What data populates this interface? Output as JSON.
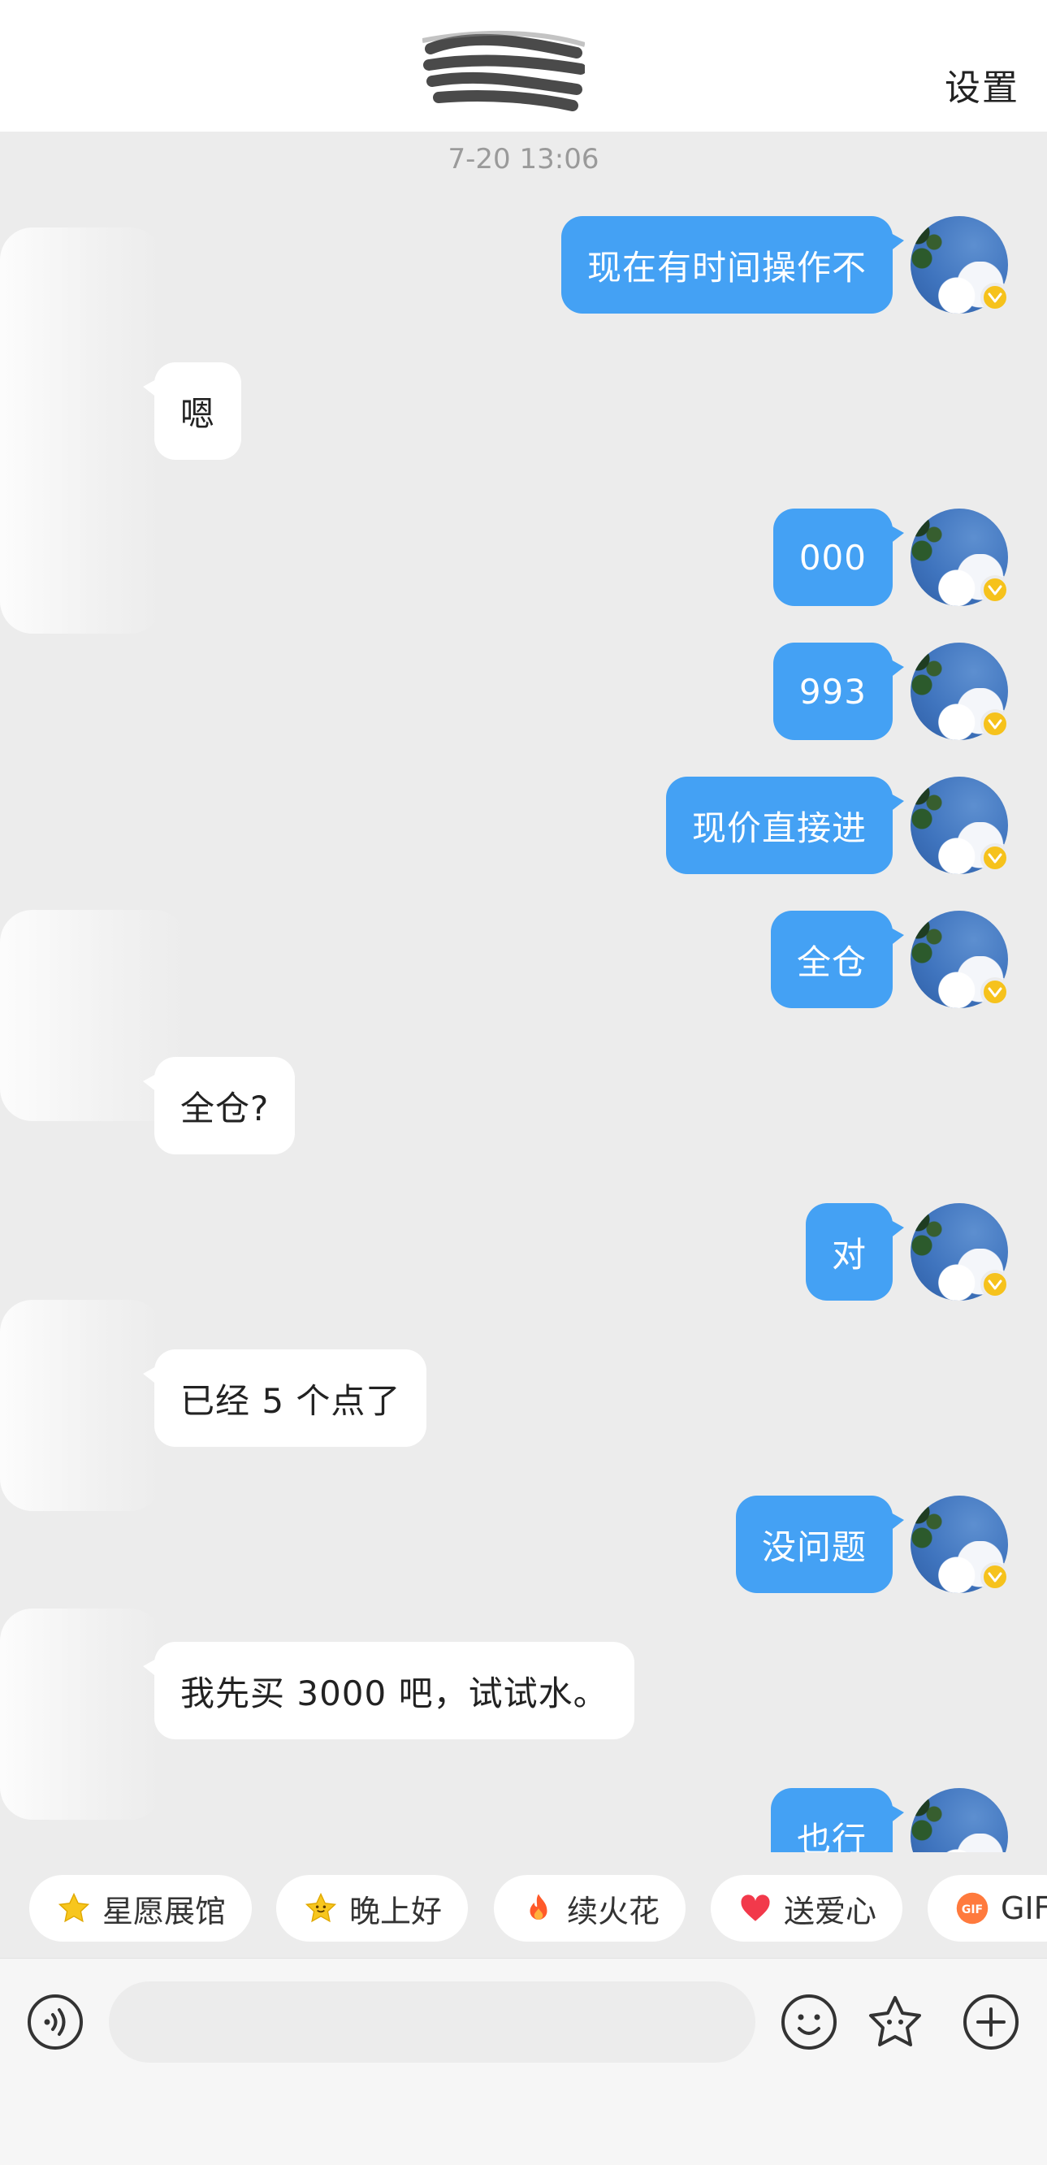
{
  "header": {
    "settings_label": "设置"
  },
  "chat": {
    "timestamp": "7-20 13:06",
    "messages": [
      {
        "side": "out",
        "text": "现在有时间操作不"
      },
      {
        "side": "in",
        "text": "嗯"
      },
      {
        "side": "out",
        "text": "000"
      },
      {
        "side": "out",
        "text": "993"
      },
      {
        "side": "out",
        "text": "现价直接进"
      },
      {
        "side": "out",
        "text": "全仓"
      },
      {
        "side": "in",
        "text": "全仓?"
      },
      {
        "side": "out",
        "text": "对"
      },
      {
        "side": "in",
        "text": "已经 5 个点了"
      },
      {
        "side": "out",
        "text": "没问题"
      },
      {
        "side": "in",
        "text": "我先买 3000 吧，试试水。"
      },
      {
        "side": "out",
        "text": "也行"
      }
    ]
  },
  "quick_actions": [
    {
      "icon": "star-icon",
      "label": "星愿展馆"
    },
    {
      "icon": "smiling-star-icon",
      "label": "晚上好"
    },
    {
      "icon": "fire-icon",
      "label": "续火花"
    },
    {
      "icon": "heart-icon",
      "label": "送爱心"
    },
    {
      "icon": "gif-icon",
      "label": "GIF"
    }
  ],
  "input_bar": {
    "placeholder": "",
    "icons": [
      "voice-icon",
      "emoji-icon",
      "star-sticker-icon",
      "plus-icon"
    ]
  },
  "colors": {
    "outgoing_bubble": "#44a1f4",
    "incoming_bubble": "#ffffff",
    "background": "#ececec",
    "badge": "#f6c21c"
  }
}
